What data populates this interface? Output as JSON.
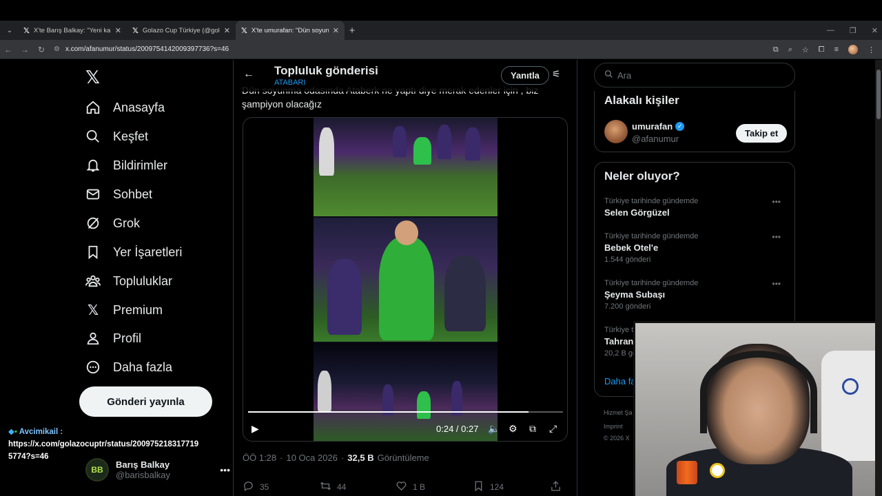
{
  "browser": {
    "tabs": [
      {
        "title": "X'te Barış Balkay: \"Yeni kamera",
        "active": false
      },
      {
        "title": "Golazo Cup Türkiye (@golazocu",
        "active": false
      },
      {
        "title": "X'te umurafan: \"Dün soyunma",
        "active": true
      }
    ],
    "url": "x.com/afanumur/status/2009754142009397736?s=46"
  },
  "sidebar": {
    "items": [
      {
        "label": "Anasayfa",
        "icon": "home-icon"
      },
      {
        "label": "Keşfet",
        "icon": "search-icon"
      },
      {
        "label": "Bildirimler",
        "icon": "bell-icon"
      },
      {
        "label": "Sohbet",
        "icon": "mail-icon"
      },
      {
        "label": "Grok",
        "icon": "grok-icon"
      },
      {
        "label": "Yer İşaretleri",
        "icon": "bookmark-icon"
      },
      {
        "label": "Topluluklar",
        "icon": "communities-icon"
      },
      {
        "label": "Premium",
        "icon": "x-icon"
      },
      {
        "label": "Profil",
        "icon": "profile-icon"
      },
      {
        "label": "Daha fazla",
        "icon": "more-icon"
      }
    ],
    "post_button": "Gönderi yayınla",
    "account": {
      "name": "Barış Balkay",
      "handle": "@barisbalkay",
      "avatar_text": "BB"
    }
  },
  "chat_overlay": {
    "user": "Avcimikail :",
    "message": "https://x.com/golazocuptr/status/2009752183177195774?s=46"
  },
  "main": {
    "header_title": "Topluluk gönderisi",
    "header_subtitle": "ATABARI",
    "reply_button": "Yanıtla",
    "tweet_text_line1": "Dün soyunma odasında Ataberk ne yaptı diye merak edenler için , biz",
    "tweet_text_line2": "şampiyon olacağız",
    "video": {
      "time": "0:24 / 0:27",
      "progress": 0.89
    },
    "meta": {
      "time": "ÖÖ 1:28",
      "separator": "·",
      "date": "10 Oca 2026",
      "views_value": "32,5 B",
      "views_label": "Görüntüleme"
    },
    "actions": [
      {
        "icon": "reply-icon",
        "count": "35"
      },
      {
        "icon": "retweet-icon",
        "count": "44"
      },
      {
        "icon": "like-icon",
        "count": "1 B"
      },
      {
        "icon": "bookmark-icon",
        "count": "124"
      },
      {
        "icon": "share-icon",
        "count": ""
      }
    ]
  },
  "right": {
    "search_placeholder": "Ara",
    "related_title": "Alakalı kişiler",
    "person": {
      "name": "umurafan",
      "handle": "@afanumur",
      "follow": "Takip et"
    },
    "trends_title": "Neler oluyor?",
    "trends": [
      {
        "context": "Türkiye tarihinde gündemde",
        "name": "Selen Görgüzel",
        "count": ""
      },
      {
        "context": "Türkiye tarihinde gündemde",
        "name": "Bebek Otel'e",
        "count": "1.544 gönderi"
      },
      {
        "context": "Türkiye tarihinde gündemde",
        "name": "Şeyma Subaşı",
        "count": "7.200 gönderi"
      },
      {
        "context": "Türkiye t",
        "name": "Tahran",
        "count": "20,2 B gö"
      }
    ],
    "show_more": "Daha fa",
    "footer_lines": [
      "Hizmet Şa",
      "Imprint",
      "© 2026 X"
    ]
  }
}
